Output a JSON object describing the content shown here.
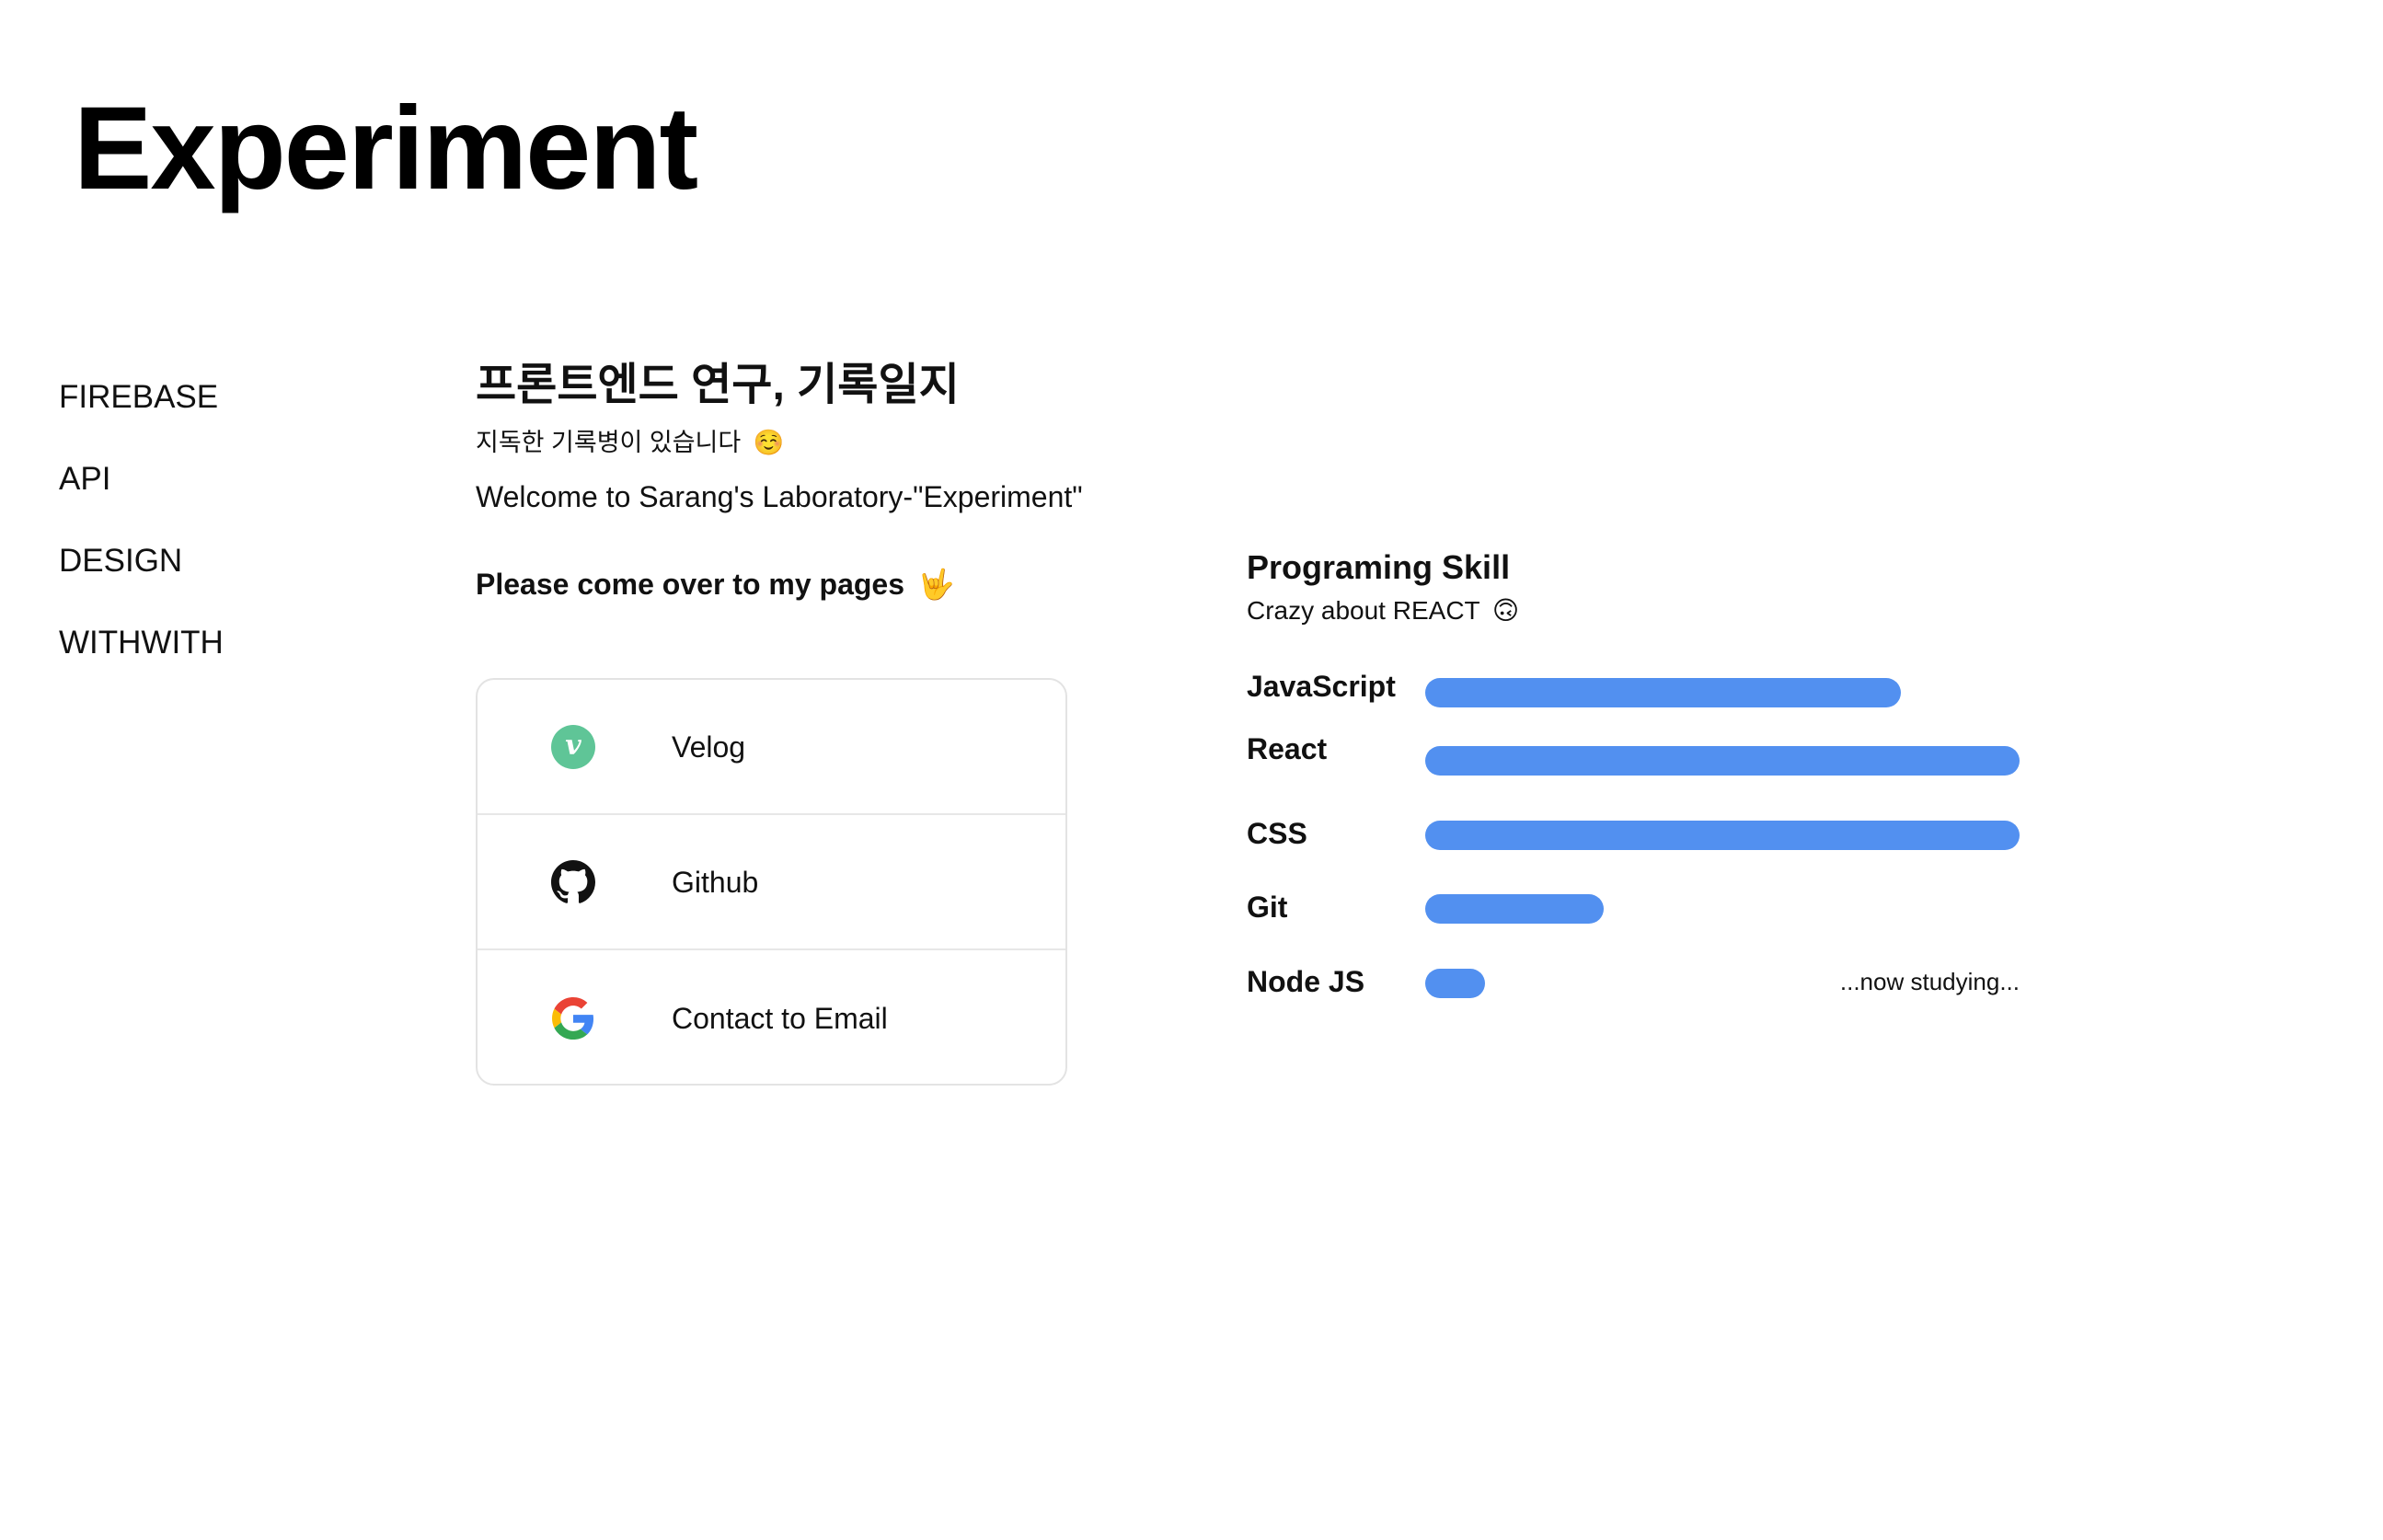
{
  "page": {
    "title": "Experiment"
  },
  "sidebar": {
    "items": [
      {
        "label": "FIREBASE"
      },
      {
        "label": "API"
      },
      {
        "label": "DESIGN"
      },
      {
        "label": "WITHWITH"
      }
    ]
  },
  "intro": {
    "heading": "프론트엔드 연구, 기록일지",
    "subtitle": "지독한 기록병이 있습니다",
    "subtitle_emoji": "☺️",
    "welcome": "Welcome to Sarang's Laboratory-\"Experiment\"",
    "cta": "Please come over to my pages",
    "cta_emoji": "🤟"
  },
  "links": [
    {
      "label": "Velog",
      "icon": "velog-icon",
      "badge_text": "v"
    },
    {
      "label": "Github",
      "icon": "github-icon"
    },
    {
      "label": "Contact to Email",
      "icon": "google-icon"
    }
  ],
  "skills": {
    "title": "Programing Skill",
    "subtitle": "Crazy about REACT",
    "subtitle_emoji": "🙃",
    "bar_color": "#5290f0",
    "items": [
      {
        "name": "JavaScript",
        "level": 0.8
      },
      {
        "name": "React",
        "level": 1.0
      },
      {
        "name": "CSS",
        "level": 1.0
      },
      {
        "name": "Git",
        "level": 0.3
      },
      {
        "name": "Node JS",
        "level": 0.1,
        "note": "...now studying..."
      }
    ]
  }
}
